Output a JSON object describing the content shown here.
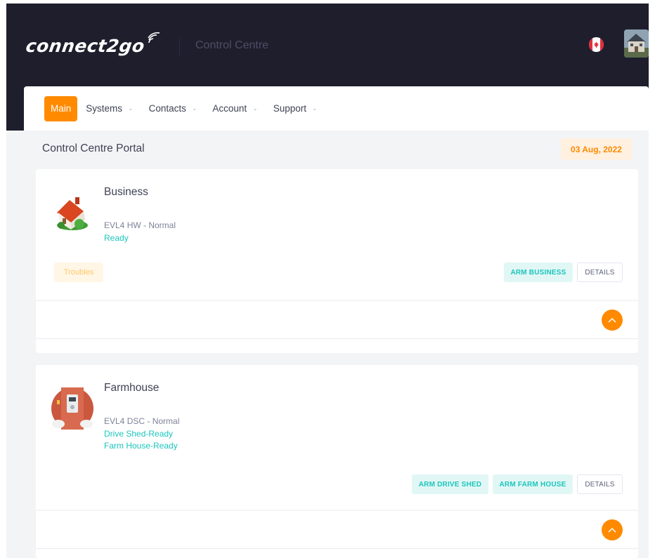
{
  "header": {
    "logo_text": "connect2go",
    "title": "Control Centre",
    "flag_icon": "canada-flag-icon",
    "avatar_icon": "user-avatar-house-photo"
  },
  "nav": {
    "items": [
      {
        "label": "Main",
        "active": true
      },
      {
        "label": "Systems",
        "dropdown": true
      },
      {
        "label": "Contacts",
        "dropdown": true
      },
      {
        "label": "Account",
        "dropdown": true
      },
      {
        "label": "Support",
        "dropdown": true
      }
    ]
  },
  "subheader": {
    "title": "Control Centre Portal",
    "date": "03 Aug, 2022"
  },
  "systems": [
    {
      "name": "Business",
      "icon": "house-icon",
      "model": "EVL4 HW - Normal",
      "statuses": [
        "Ready"
      ],
      "badge": "Troubles",
      "buttons": [
        "ARM BUSINESS",
        "DETAILS"
      ]
    },
    {
      "name": "Farmhouse",
      "icon": "keypad-panel-icon",
      "model": "EVL4 DSC - Normal",
      "statuses": [
        "Drive Shed-Ready",
        "Farm House-Ready"
      ],
      "buttons": [
        "ARM DRIVE SHED",
        "ARM FARM HOUSE",
        "DETAILS"
      ]
    }
  ],
  "colors": {
    "header_bg": "#1e1e2d",
    "accent": "#ff8a00",
    "teal": "#1bc5bd",
    "warning": "#ffc86a"
  }
}
